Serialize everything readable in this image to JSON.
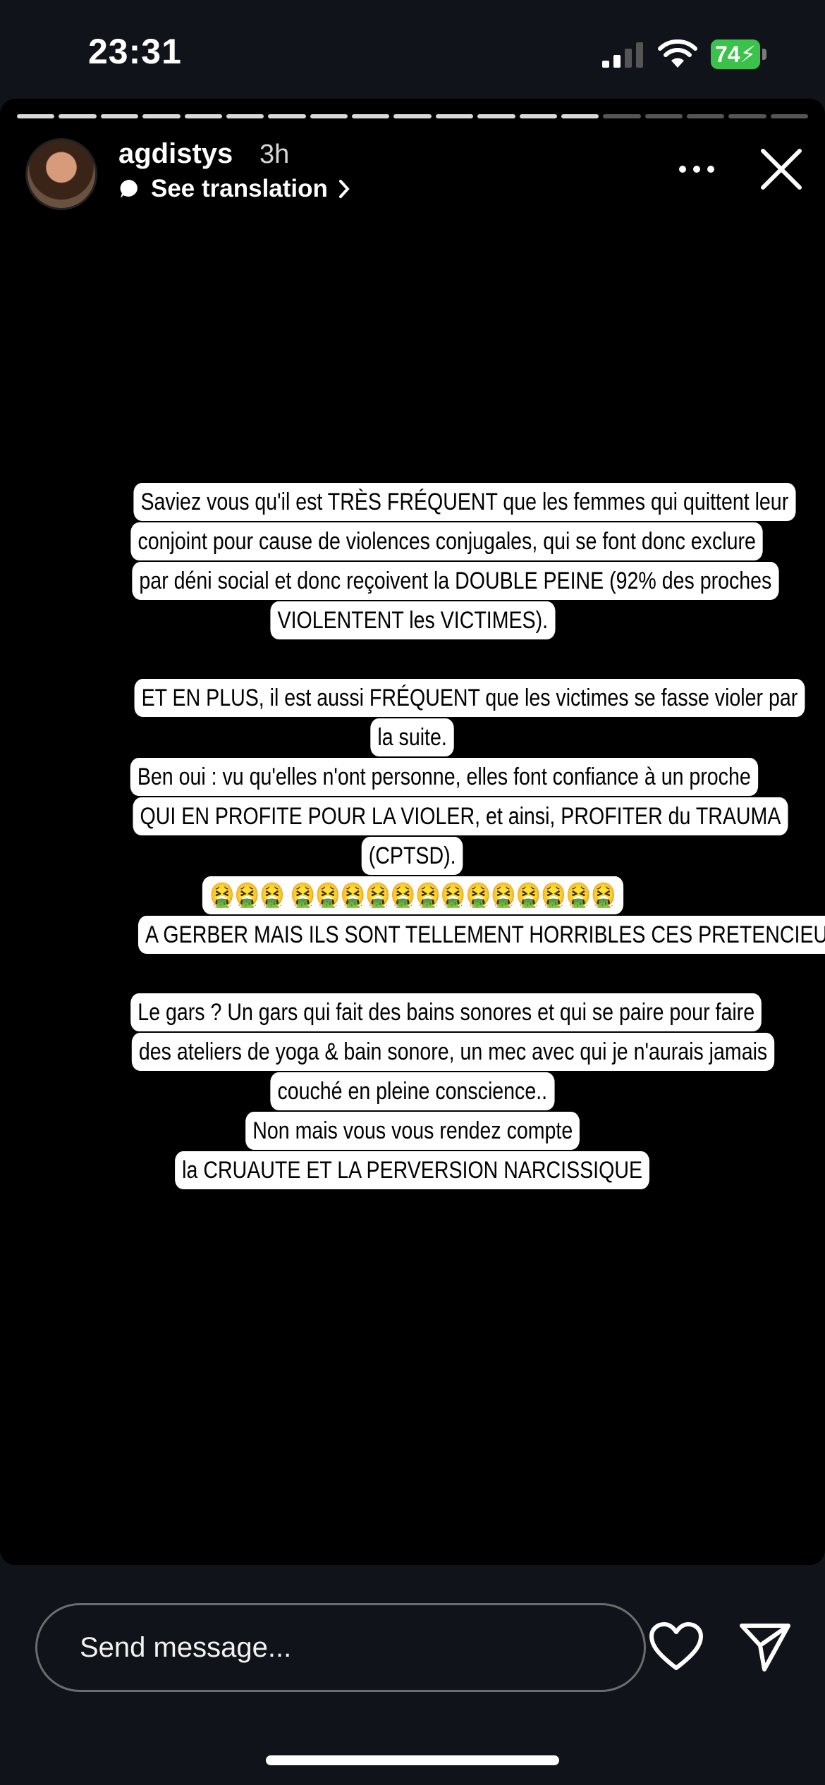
{
  "status_bar": {
    "time": "23:31",
    "battery": "74"
  },
  "story": {
    "username": "agdistys",
    "age": "3h",
    "translate_label": "See translation",
    "segments_total": 19,
    "segments_done": 14,
    "blocks": [
      [
        "Saviez vous qu'il est TRÈS FRÉQUENT que les femmes qui quittent leur",
        "conjoint pour cause de violences conjugales, qui se font donc exclure",
        "par déni social et donc reçoivent la DOUBLE PEINE (92% des proches",
        "VIOLENTENT les VICTIMES)."
      ],
      [
        "ET EN PLUS, il est aussi FRÉQUENT que les victimes se fasse violer par",
        "la suite.",
        "Ben oui : vu qu'elles n'ont personne, elles font confiance à un proche",
        "QUI EN PROFITE POUR LA VIOLER, et ainsi, PROFITER du TRAUMA",
        "(CPTSD).",
        "🤮🤮🤮 🤮🤮🤮🤮🤮🤮🤮🤮🤮🤮🤮🤮🤮",
        "A GERBER MAIS ILS SONT TELLEMENT HORRIBLES CES PRETENCIEUX"
      ],
      [
        "Le gars ? Un gars qui fait des bains sonores et qui se paire pour faire",
        "des ateliers de yoga & bain sonore, un mec avec qui je n'aurais jamais",
        "couché en pleine conscience..",
        "Non mais vous vous rendez compte",
        "la CRUAUTE ET LA PERVERSION NARCISSIQUE"
      ]
    ]
  },
  "footer": {
    "message_placeholder": "Send message..."
  }
}
